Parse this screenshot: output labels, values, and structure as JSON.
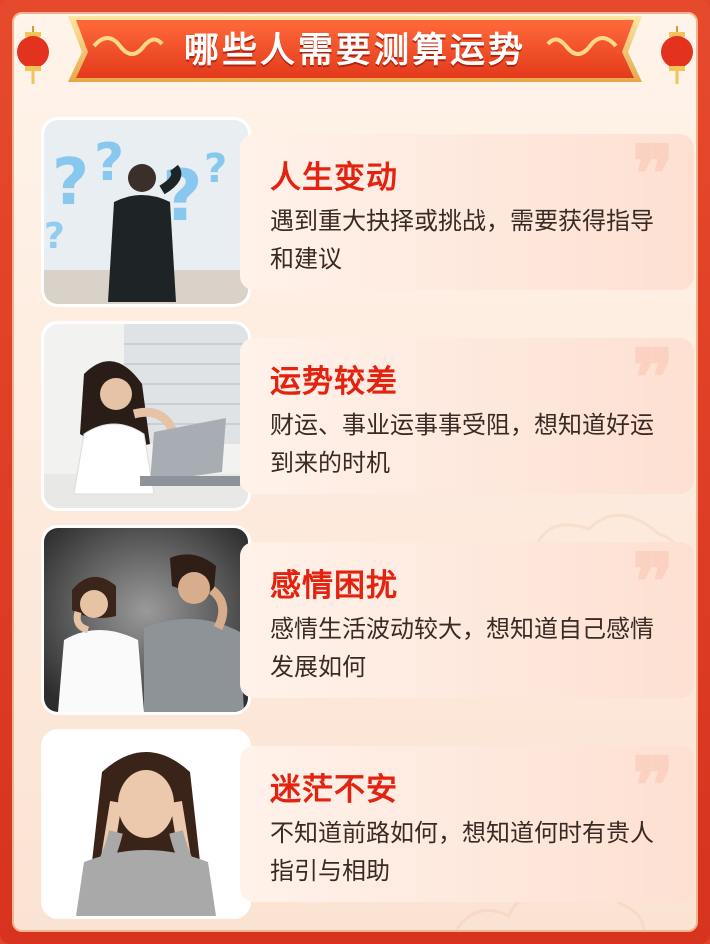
{
  "header": {
    "title": "哪些人需要测算运势"
  },
  "items": [
    {
      "title": "人生变动",
      "desc": "遇到重大抉择或挑战，需要获得指导和建议",
      "photo": "man-facing-question-marks"
    },
    {
      "title": "运势较差",
      "desc": "财运、事业运事事受阻，想知道好运到来的时机",
      "photo": "woman-stressed-at-laptop"
    },
    {
      "title": "感情困扰",
      "desc": "感情生活波动较大，想知道自己感情发展如何",
      "photo": "couple-back-to-back"
    },
    {
      "title": "迷茫不安",
      "desc": "不知道前路如何，想知道何时有贵人指引与相助",
      "photo": "woman-holding-head"
    }
  ],
  "quote_glyph": "❞",
  "colors": {
    "accent": "#e3220f",
    "frame": "#e2452a",
    "text": "#3a2a24"
  }
}
